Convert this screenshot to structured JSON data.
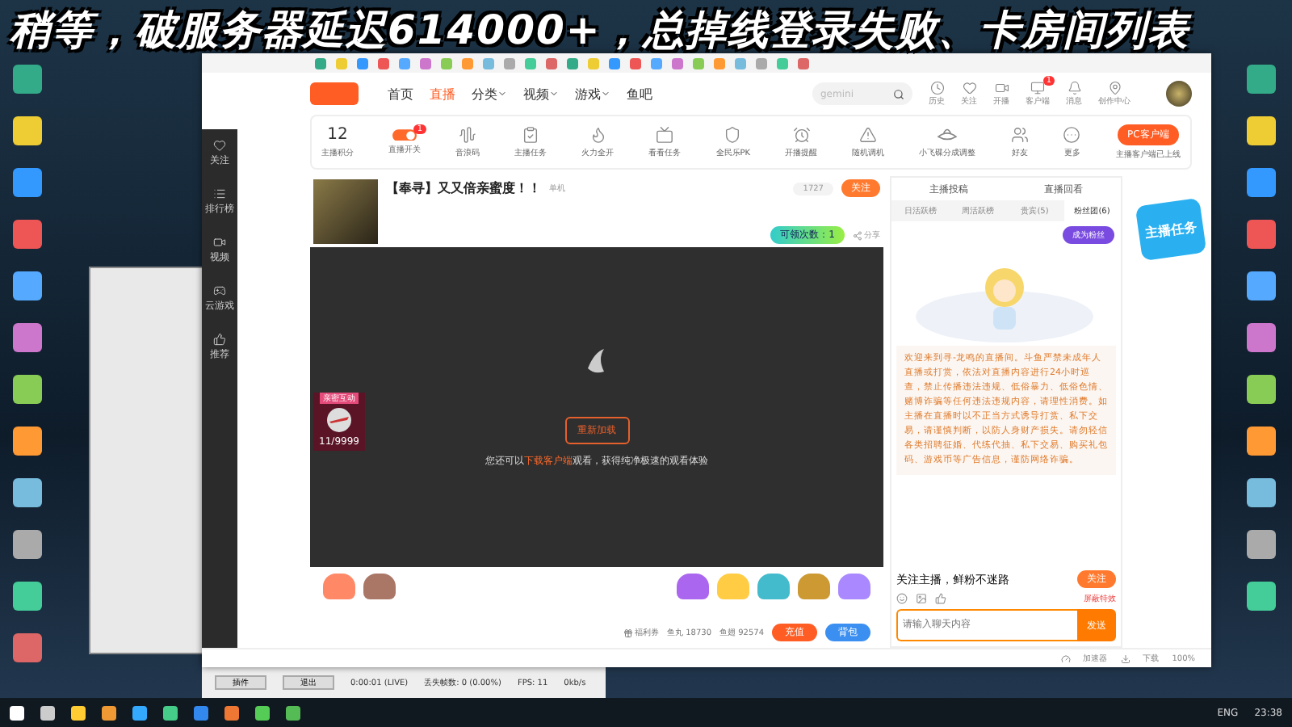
{
  "caption": "稍等，破服务器延迟614000+，总掉线登录失败、卡房间列表",
  "nav": [
    {
      "label": "首页",
      "selected": false,
      "menu": false
    },
    {
      "label": "直播",
      "selected": true,
      "menu": false
    },
    {
      "label": "分类",
      "selected": false,
      "menu": true
    },
    {
      "label": "视频",
      "selected": false,
      "menu": true
    },
    {
      "label": "游戏",
      "selected": false,
      "menu": true
    },
    {
      "label": "鱼吧",
      "selected": false,
      "menu": false
    }
  ],
  "search": {
    "placeholder": "gemini"
  },
  "header_icons": [
    {
      "label": "历史"
    },
    {
      "label": "关注"
    },
    {
      "label": "开播"
    },
    {
      "label": "客户端",
      "badge": "1"
    },
    {
      "label": "消息"
    },
    {
      "label": "创作中心"
    }
  ],
  "score": {
    "value": "12",
    "label": "主播积分"
  },
  "tools": [
    {
      "label": "直播开关",
      "badge": "1"
    },
    {
      "label": "音浪码"
    },
    {
      "label": "主播任务"
    },
    {
      "label": "火力全开"
    },
    {
      "label": "看看任务"
    },
    {
      "label": "全民乐PK"
    },
    {
      "label": "开播提醒"
    },
    {
      "label": "随机调机"
    },
    {
      "label": "小飞碟分成调整"
    },
    {
      "label": "好友"
    },
    {
      "label": "更多"
    }
  ],
  "pc_client": {
    "button": "PC客户端",
    "note": "主播客户端已上线"
  },
  "sidebar": [
    {
      "label": "关注"
    },
    {
      "label": "排行榜"
    },
    {
      "label": "视频"
    },
    {
      "label": "云游戏"
    },
    {
      "label": "推荐"
    }
  ],
  "room": {
    "title": "【奉寻】又又倍亲蜜度！！",
    "category": "单机",
    "follow_count": "1727",
    "follow": "关注",
    "claim": "可领次数：1",
    "share": "分享"
  },
  "player": {
    "reload": "重新加载",
    "hint_before": "您还可以",
    "hint_link": "下载客户端",
    "hint_after": "观看，获得纯净极速的观看体验",
    "interact_title": "亲密互动",
    "interact_count": "11/9999"
  },
  "gift_bar": {
    "welfare": "福利券",
    "yuwan": "鱼丸 18730",
    "yuchi": "鱼翅 92574",
    "recharge": "充值",
    "bag": "背包"
  },
  "chat": {
    "links": [
      "主播投稿",
      "直播回看"
    ],
    "tabs": [
      {
        "label": "日活跃榜",
        "selected": false
      },
      {
        "label": "周活跃榜",
        "selected": false
      },
      {
        "label": "贵宾(5)",
        "selected": false
      },
      {
        "label": "粉丝团(6)",
        "selected": true
      }
    ],
    "become_fan": "成为粉丝",
    "notice": "欢迎来到寻-龙鸣的直播间。斗鱼严禁未成年人直播或打赏，依法对直播内容进行24小时巡查，禁止传播违法违规、低俗暴力、低俗色情、赌博诈骗等任何违法违规内容，请理性消费。如主播在直播时以不正当方式诱导打赏、私下交易，请谨慎判断，以防人身财产损失。请勿轻信各类招聘征婚、代练代抽、私下交易、购买礼包码、游戏币等广告信息，谨防网络诈骗。",
    "follow_prompt": "关注主播，鲜粉不迷路",
    "follow": "关注",
    "shield": "屏蔽特效",
    "placeholder": "请输入聊天内容",
    "send": "发送"
  },
  "promo": "主播任务",
  "status_bar": {
    "items": [
      "加速器",
      "下载"
    ],
    "zoom": "100%"
  },
  "obs": {
    "time": "0:00:01 (LIVE)",
    "dropped": "丢失帧数: 0 (0.00%)",
    "fps": "FPS: 11",
    "rate": "0kb/s",
    "buttons": [
      "插件",
      "退出"
    ]
  },
  "taskbar": {
    "lang": "ENG",
    "time": "23:38"
  }
}
